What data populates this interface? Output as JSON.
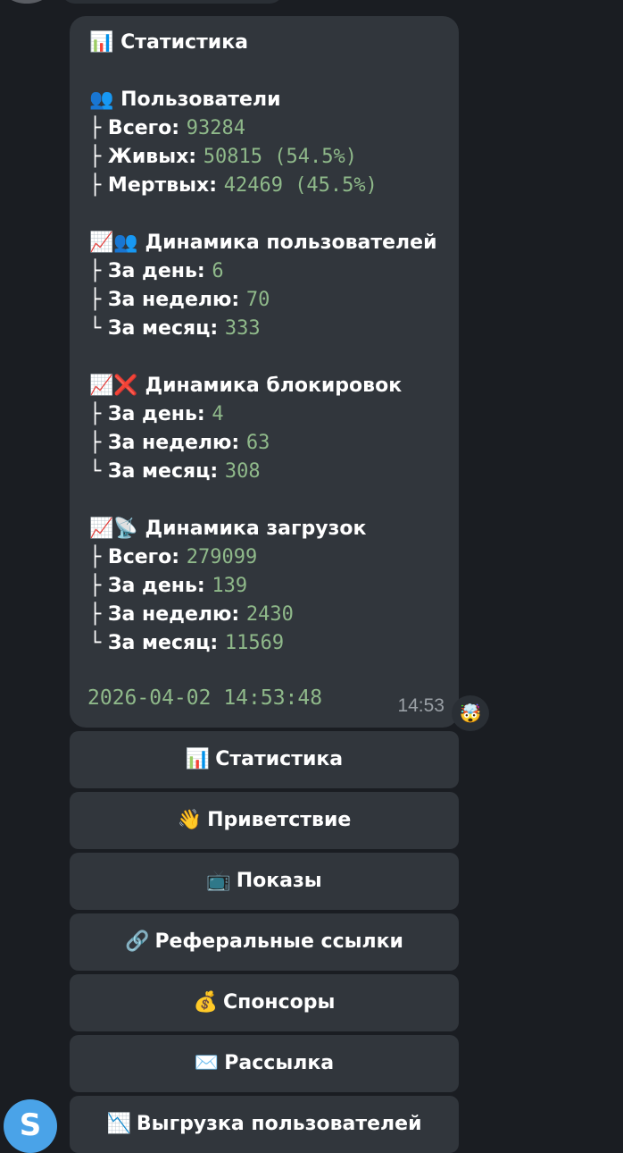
{
  "message": {
    "title_icon": "📊",
    "title": "Статистика",
    "sections": {
      "users": {
        "icon": "👥",
        "title": "Пользователи",
        "total_label": "Всего:",
        "total_value": "93284",
        "alive_label": "Живых:",
        "alive_value": "50815 (54.5%)",
        "dead_label": "Мертвых:",
        "dead_value": "42469 (45.5%)"
      },
      "user_dynamics": {
        "icon1": "📈",
        "icon2": "👥",
        "title": "Динамика пользователей",
        "day_label": "За день:",
        "day_value": "6",
        "week_label": "За неделю:",
        "week_value": "70",
        "month_label": "За месяц:",
        "month_value": "333"
      },
      "block_dynamics": {
        "icon1": "📈",
        "icon2": "❌",
        "title": "Динамика блокировок",
        "day_label": "За день:",
        "day_value": "4",
        "week_label": "За неделю:",
        "week_value": "63",
        "month_label": "За месяц:",
        "month_value": "308"
      },
      "download_dynamics": {
        "icon1": "📈",
        "icon2": "📡",
        "title": "Динамика загрузок",
        "total_label": "Всего:",
        "total_value": "279099",
        "day_label": "За день:",
        "day_value": "139",
        "week_label": "За неделю:",
        "week_value": "2430",
        "month_label": "За месяц:",
        "month_value": "11569"
      }
    },
    "tree_mid": "├",
    "tree_end": "└",
    "datetime": "2026-04-02 14:53:48",
    "time": "14:53",
    "reaction": "🤯"
  },
  "keyboard": [
    {
      "icon": "📊",
      "label": "Статистика"
    },
    {
      "icon": "👋",
      "label": "Приветствие"
    },
    {
      "icon": "📺",
      "label": "Показы"
    },
    {
      "icon": "🔗",
      "label": "Реферальные ссылки"
    },
    {
      "icon": "💰",
      "label": "Спонсоры"
    },
    {
      "icon": "✉️",
      "label": "Рассылка"
    },
    {
      "icon": "📉",
      "label": "Выгрузка пользователей"
    }
  ],
  "sender_avatar_letter": "S",
  "colors": {
    "background": "#1a1d22",
    "bubble": "#31363c",
    "value_green": "#8fb98a",
    "avatar": "#4aa3e8"
  }
}
